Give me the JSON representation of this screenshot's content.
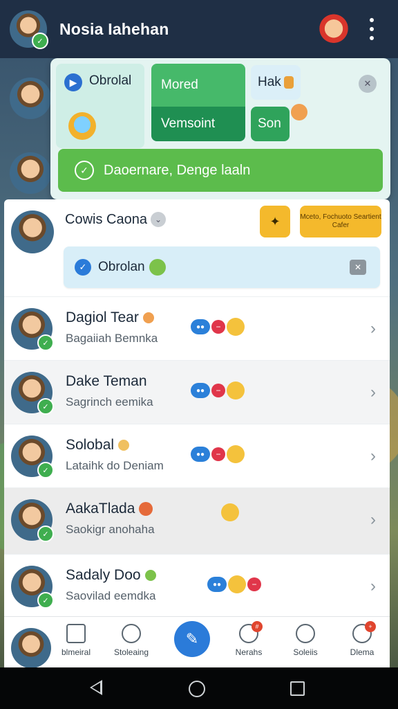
{
  "header": {
    "title": "Nosia Iahehan"
  },
  "popup": {
    "obrolal_label": "Obrolal",
    "mored_label": "Mored",
    "vem_label": "Vemsoint",
    "hak_label": "Hak",
    "son_label": "Son",
    "banner_text": "Daoernare, Denge laaln"
  },
  "conversation": {
    "name": "Cowis Caona",
    "promo_text": "Mceto, Fochuoto Seartient Cafer",
    "pill_text": "Obrolan"
  },
  "contacts": [
    {
      "name": "Dagiol Tear",
      "subtitle": "Bagaiiah Bemnka"
    },
    {
      "name": "Dake Teman",
      "subtitle": "Sagrinch eemika"
    },
    {
      "name": "Solobal",
      "subtitle": "Lataihk do Deniam"
    },
    {
      "name": "AakaTlada",
      "subtitle": "Saokigr anohaha"
    },
    {
      "name": "Sadaly Doo",
      "subtitle": "Saovilad eemdka"
    }
  ],
  "bottom_nav": [
    {
      "label": "blmeiral"
    },
    {
      "label": "Stoleaing"
    },
    {
      "label": "Nerahs",
      "badge": "#"
    },
    {
      "label": "Soleiis"
    },
    {
      "label": "Dlema",
      "badge": "+"
    }
  ],
  "colors": {
    "accent_blue": "#2b7bd9",
    "green": "#5cbc4c",
    "dark_green": "#1f8f52",
    "yellow": "#f4b92c",
    "topbar": "#1f2f45"
  }
}
